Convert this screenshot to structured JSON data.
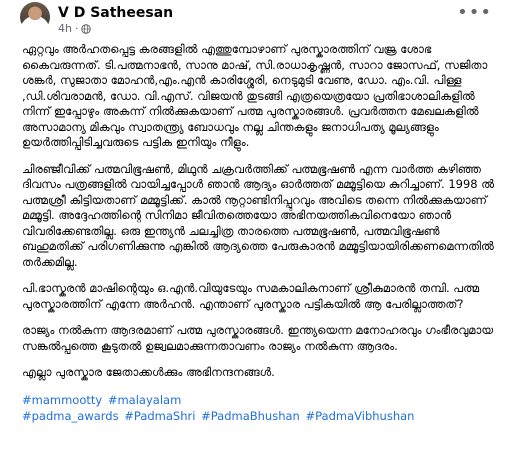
{
  "author": "V D Satheesan",
  "time": "4h",
  "post": {
    "paragraphs": [
      "ഏറ്റവും അർഹതപ്പെട്ട കരങ്ങളിൽ എത്തുമ്പോഴാണ് പുരസ്കാരത്തിന് വജ്ര ശോഭ കൈവരുന്നത്. ടി.പത്മനാഭൻ, സാനു മാഷ്, സി.രാധാകൃഷ്ണൻ, സാറാ ജോസഫ്, സജിതാ ശങ്കർ, സുജാതാ മോഹൻ,എം.എൻ കാരിശ്ശേരി, നെടുമുടി വേണു, ഡോ. എം.വി. പിള്ള ,ഡി.ശിവരാമൻ, ഡോ. വി.എസ്. വിജയൻ തുടങ്ങി എത്രയെത്രയോ പ്രതിഭാശാലികളിൽ നിന്ന് ഇപ്പോഴും അകന്ന് നിൽക്കുകയാണ് പത്മ പുരസ്കാരങ്ങൾ. പ്രവർത്തന മേഖലകളിൽ അസാമാന്യ മികവും സ്വാതന്ത്ര്യ ബോധവും നല്ല ചിന്തകളും ജനാധിപത്യ മൂല്യങ്ങളും ഉയർത്തിപ്പിടിച്ചവരുടെ പട്ടിക ഇനിയും നീളും.",
      "ചിരഞ്ജീവിക്ക് പത്മവിഭൂഷൺ, മിഥുൻ ചക്രവർത്തിക്ക് പത്മഭൂഷൺ എന്ന വാർത്ത കഴിഞ്ഞ ദിവസം പത്രങ്ങളിൽ വായിച്ചപ്പോൾ ഞാൻ ആദ്യം ഓർത്തത് മമ്മൂട്ടിയെ കുറിച്ചാണ്. 1998 ൽ പത്മശ്രീ കിട്ടിയതാണ് മമ്മൂട്ടിക്ക്. കാൽ നൂറ്റാണ്ടിനിപ്പുറവും അവിടെ തന്നെ നിൽക്കുകയാണ് മമ്മൂട്ടി. അദ്ദേഹത്തിന്റെ സിനിമാ ജീവിതത്തെയോ അഭിനയത്തികവിനെയോ ഞാൻ വിവരിക്കേണ്ടതില്ല. ഒരു ഇന്ത്യൻ ചലച്ചിത്ര താരത്തെ പത്മഭൂഷൺ, പത്മവിഭൂഷൺ ബഹുമതിക്ക് പരിഗണിക്കുന്നു എങ്കിൽ ആദ്യത്തെ പേരുകാരൻ മമ്മൂട്ടിയായിരിക്കണമെന്നതിൽ തർക്കമില്ല.",
      "പി.ഭാസ്കരൻ മാഷിന്റെയും ഒ.എൻ.വിയുടേയും സമകാലികനാണ് ശ്രീകുമാരൻ തമ്പി. പത്മ പുരസ്കാരത്തിന് എന്നേ അർഹൻ. എന്താണ് പുരസ്കാര പട്ടികയിൽ ആ പേരില്ലാത്തത്?",
      "രാജ്യം നൽകുന്ന ആദരമാണ് പത്മ പുരസ്കാരങ്ങൾ. ഇന്ത്യയെന്ന മനോഹരവും ഗംഭീരവുമായ സങ്കൽപ്പത്തെ കൂടുതൽ ഉജ്വലമാക്കുന്നതാവണം രാജ്യം നൽകുന്ന ആദരം.",
      "എല്ലാ പുരസ്കാര ജേതാക്കൾക്കും അഭിനന്ദനങ്ങൾ."
    ],
    "hashtags": [
      "#mammootty",
      "#malayalam",
      "#padma_awards",
      "#PadmaShri",
      "#PadmaBhushan",
      "#PadmaVibhushan"
    ]
  },
  "icons": {
    "privacy": "globe-icon",
    "menu": "more-options-icon"
  }
}
